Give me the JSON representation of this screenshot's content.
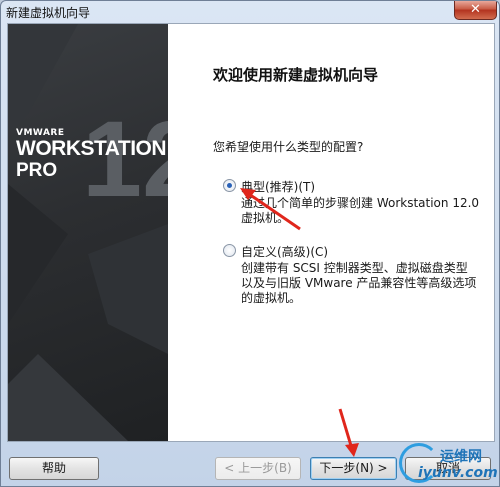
{
  "window": {
    "title": "新建虚拟机向导",
    "close_symbol": "✕"
  },
  "banner": {
    "brand_small": "VMWARE",
    "brand_product": "WORKSTATION",
    "brand_edition": "PRO",
    "version": "12"
  },
  "main": {
    "heading": "欢迎使用新建虚拟机向导",
    "question": "您希望使用什么类型的配置?",
    "options": [
      {
        "label": "典型(推荐)(T)",
        "checked": true,
        "desc_line1": "通过几个简单的步骤创建 Workstation 12.0",
        "desc_line2": "虚拟机。"
      },
      {
        "label": "自定义(高级)(C)",
        "checked": false,
        "desc_line1": "创建带有 SCSI 控制器类型、虚拟磁盘类型",
        "desc_line2": "以及与旧版 VMware 产品兼容性等高级选项",
        "desc_line3": "的虚拟机。"
      }
    ]
  },
  "buttons": {
    "help": "帮助",
    "back": "< 上一步(B)",
    "next": "下一步(N) >",
    "cancel": "取消"
  },
  "watermark": {
    "text1": "运维网",
    "text2": "iyunv.com"
  },
  "colors": {
    "banner_dark": "#2c2e31",
    "accent_blue": "#2a62b8",
    "annotation_red": "#e0261c"
  }
}
